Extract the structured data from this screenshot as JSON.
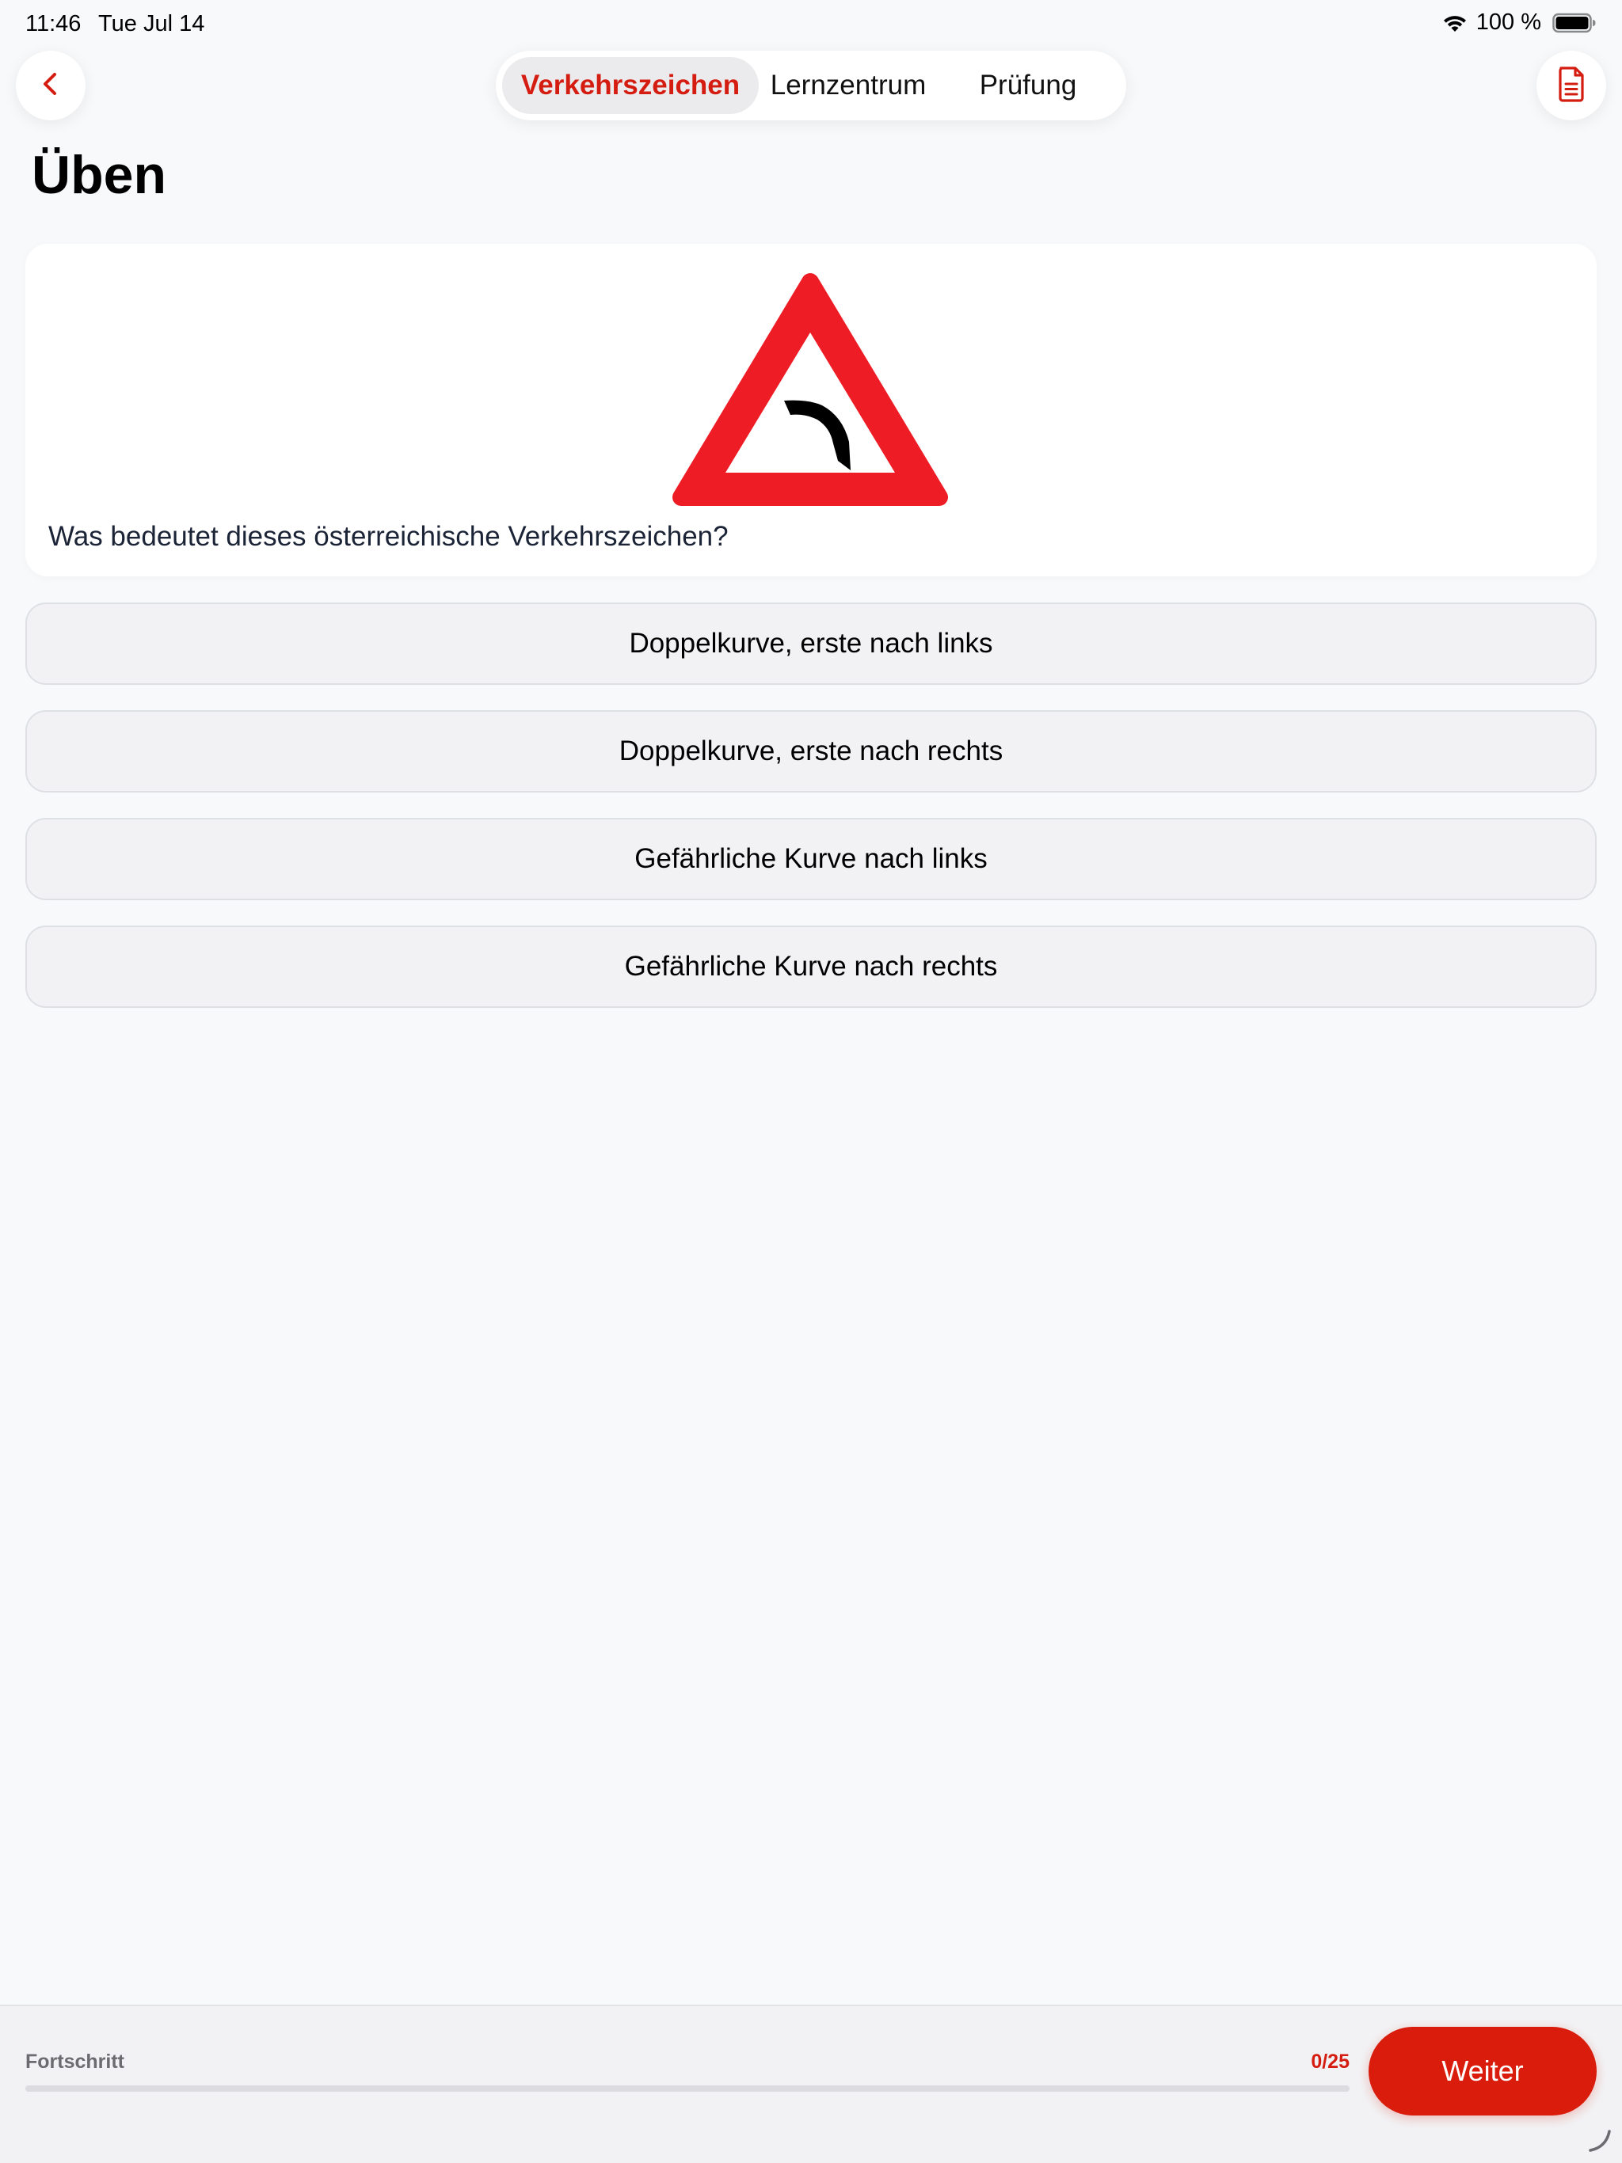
{
  "status_bar": {
    "time": "11:46",
    "date": "Tue Jul 14",
    "battery_percent": "100 %",
    "icons": [
      "wifi-icon",
      "battery-icon"
    ]
  },
  "nav": {
    "back_icon": "chevron-left-icon",
    "document_icon": "document-icon",
    "tabs": [
      {
        "label": "Verkehrszeichen",
        "selected": true
      },
      {
        "label": "Lernzentrum",
        "selected": false
      },
      {
        "label": "Prüfung",
        "selected": false
      }
    ]
  },
  "page": {
    "title": "Üben"
  },
  "question": {
    "sign_icon": "warning-sign-curve-left-icon",
    "text": "Was bedeutet dieses österreichische Verkehrszeichen?",
    "answers": [
      {
        "label": "Doppelkurve, erste nach links"
      },
      {
        "label": "Doppelkurve, erste nach rechts"
      },
      {
        "label": "Gefährliche Kurve nach links"
      },
      {
        "label": "Gefährliche Kurve nach rechts"
      }
    ]
  },
  "footer": {
    "progress_label": "Fortschritt",
    "progress_count": "0/25",
    "progress_fraction": 0,
    "next_label": "Weiter"
  },
  "colors": {
    "accent": "#d41c10",
    "button_red": "#d91c0b",
    "sign_red": "#ee1c25",
    "background": "#f8f9fb"
  }
}
